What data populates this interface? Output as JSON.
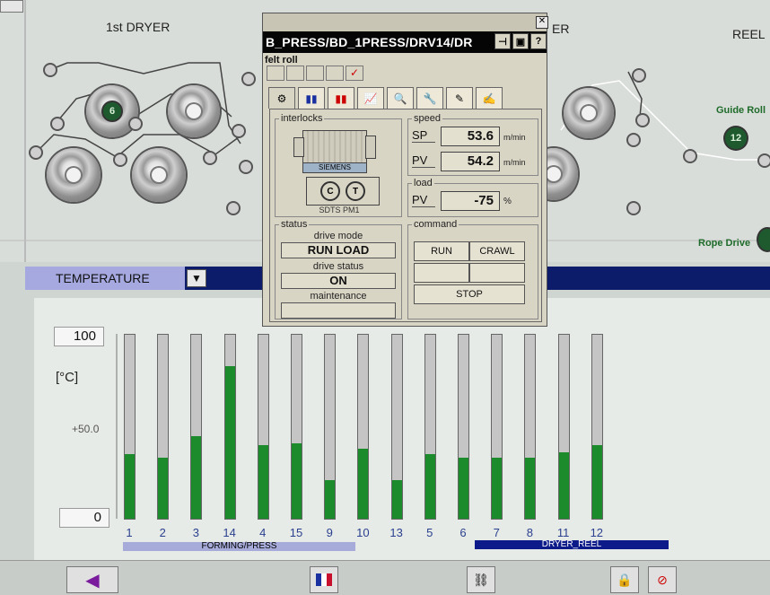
{
  "process": {
    "dryer_title": "1st DRYER",
    "partial_title": "ER",
    "reel_title": "REEL",
    "guide_roll_label": "Guide Roll",
    "guide_roll_number": "12",
    "rope_drive_label": "Rope Drive",
    "dryer_roll_number": "6"
  },
  "faceplate": {
    "title": "B_PRESS/BD_1PRESS/DRV14/DR",
    "felt_roll_label": "felt roll",
    "groups": {
      "interlocks": "interlocks",
      "speed": "speed",
      "load": "load",
      "status": "status",
      "command": "command"
    },
    "motor_brand": "SIEMENS",
    "motor_system": "SDTS PM1",
    "speed": {
      "sp_label": "SP",
      "sp_value": "53.6",
      "sp_unit": "m/min",
      "pv_label": "PV",
      "pv_value": "54.2",
      "pv_unit": "m/min"
    },
    "load": {
      "pv_label": "PV",
      "pv_value": "-75",
      "unit": "%"
    },
    "status": {
      "drive_mode_label": "drive mode",
      "drive_mode_value": "RUN LOAD",
      "drive_status_label": "drive status",
      "drive_status_value": "ON",
      "maintenance_label": "maintenance",
      "maintenance_value": ""
    },
    "command": {
      "run": "RUN",
      "crawl": "CRAWL",
      "stop": "STOP"
    }
  },
  "temperature": {
    "selector": "TEMPERATURE",
    "unit_label": "[°C]",
    "max_value": "100",
    "min_value": "0",
    "mid_tick": "+50.0",
    "groups": [
      {
        "name": "FORMING/PRESS",
        "color": "#a6abd9"
      },
      {
        "name": "DRYER_REEL",
        "color": "#0d1b8a"
      }
    ]
  },
  "chart_data": {
    "type": "bar",
    "categories": [
      "1",
      "2",
      "3",
      "14",
      "4",
      "15",
      "9",
      "10",
      "13",
      "5",
      "6",
      "7",
      "8",
      "11",
      "12"
    ],
    "values": [
      35,
      33,
      45,
      83,
      40,
      41,
      21,
      38,
      21,
      35,
      33,
      33,
      33,
      36,
      40
    ],
    "ylabel": "[°C]",
    "ylim": [
      0,
      100
    ],
    "fill_color": "#1c8b2c"
  }
}
